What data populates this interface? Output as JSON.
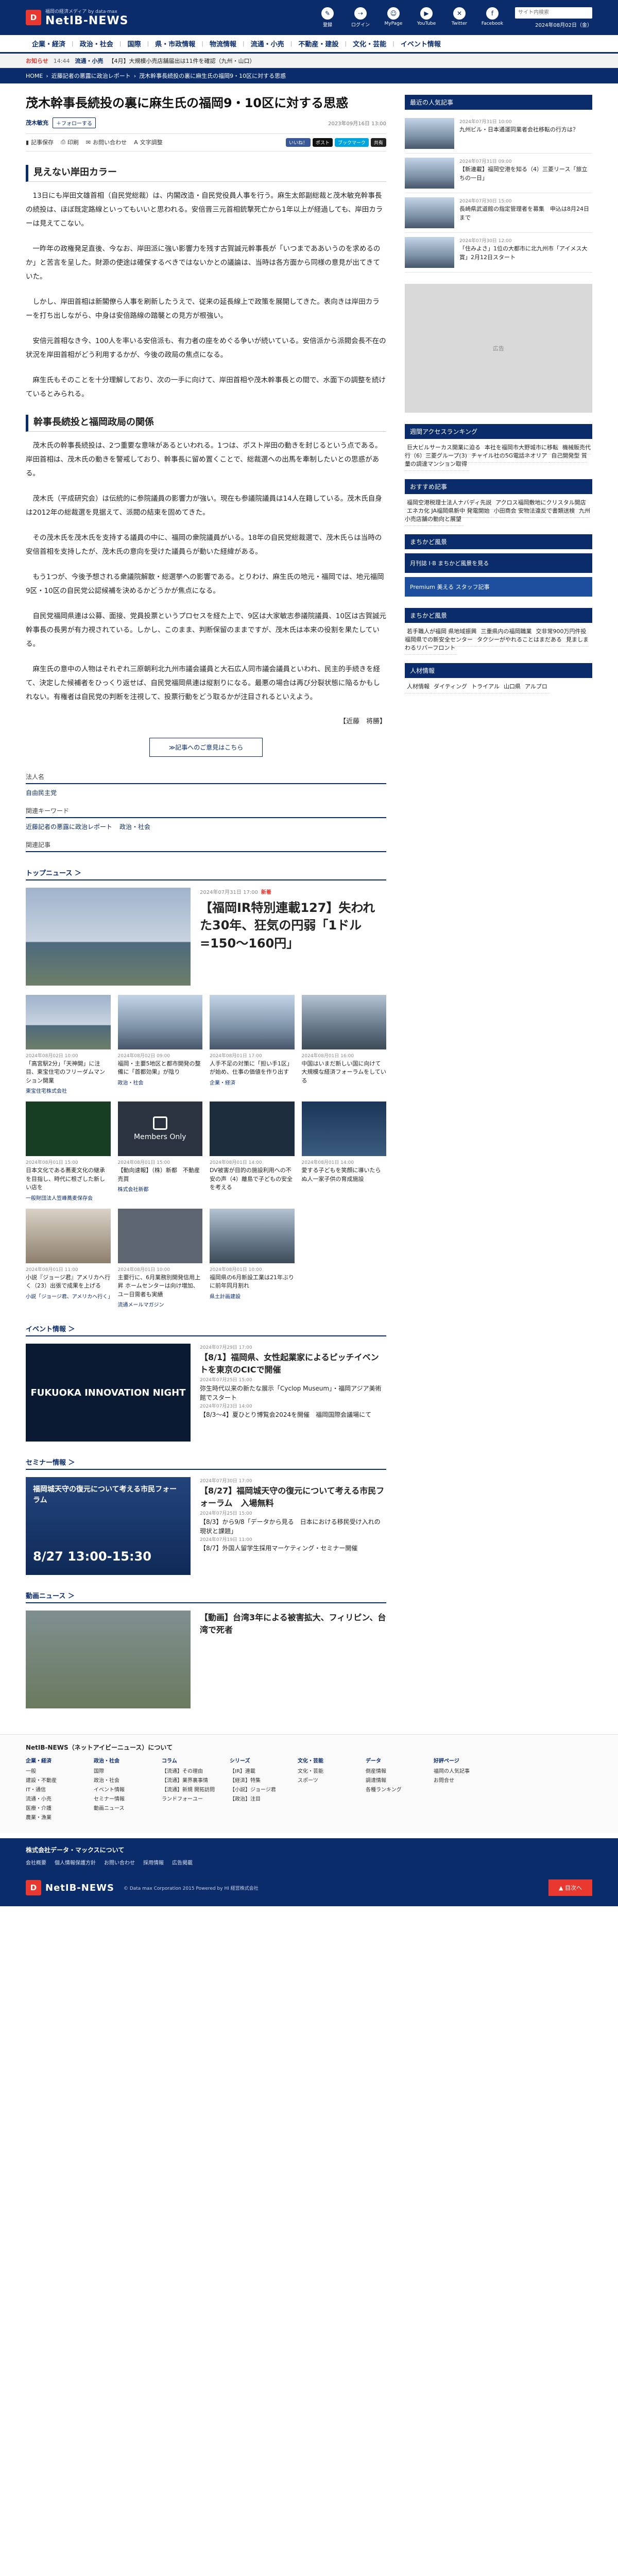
{
  "header": {
    "logo_mark": "D",
    "logo_sub": "福岡の経済メディア by data·max",
    "logo_main": "NetIB-NEWS",
    "icons": [
      {
        "label": "登録",
        "glyph": "✎"
      },
      {
        "label": "ログイン",
        "glyph": "⇢"
      },
      {
        "label": "MyPage",
        "glyph": "☺"
      },
      {
        "label": "YouTube",
        "glyph": "▶"
      },
      {
        "label": "Twitter",
        "glyph": "✕"
      },
      {
        "label": "Facebook",
        "glyph": "f"
      }
    ],
    "search_placeholder": "サイト内検索",
    "date": "2024年08月02日（金）"
  },
  "nav": [
    "企業・経済",
    "政治・社会",
    "国際",
    "県・市政情報",
    "物流情報",
    "流通・小売",
    "不動産・建設",
    "文化・芸能",
    "イベント情報"
  ],
  "ticker": {
    "label": "お知らせ",
    "time": "14:44",
    "tag": "流通・小売",
    "text": "【4月】大規模小売店舗届出は11件を確認（九州・山口）"
  },
  "breadcrumb": {
    "home": "HOME",
    "sep": "›",
    "cat": "近藤記者の悪露に政治レポート",
    "current": "茂木幹事長続投の裏に麻生氏の福岡9・10区に対する思惑"
  },
  "article": {
    "title": "茂木幹事長続投の裏に麻生氏の福岡9・10区に対する思惑",
    "author": "茂木敏充",
    "follow": "＋フォローする",
    "pubdate": "2023年09月16日 13:00",
    "tools": {
      "stock": "記事保存",
      "print": "印刷",
      "share": "お問い合わせ",
      "font": "文字調整"
    },
    "social": [
      "いいね！",
      "ポスト",
      "ブックマーク",
      "共有"
    ],
    "sections": [
      {
        "heading": "見えない岸田カラー",
        "paras": [
          "13日にも岸田文雄首相（自民党総裁）は、内閣改造・自民党役員人事を行う。麻生太郎副総裁と茂木敏充幹事長の続投は、ほぼ既定路線といってもいいと思われる。安倍晋三元首相銃撃死亡から1年以上が経過しても、岸田カラーは見えてこない。",
          "一昨年の政権発足直後、今なお、岸田派に強い影響力を残す古賀誠元幹事長が「いつまでああいうのを求めるのか」と苦言を呈した。財源の使途は確保するべきではないかとの議論は、当時は各方面から同様の意見が出てきていた。",
          "しかし、岸田首相は新閣僚ら人事を刷新したうえで、従来の延長線上で政策を展開してきた。表向きは岸田カラーを打ち出しながら、中身は安倍路線の踏襲との見方が根強い。",
          "安倍元首相なき今、100人を率いる安倍派も、有力者の座をめぐる争いが続いている。安倍派から派閥会長不在の状況を岸田首相がどう利用するかが、今後の政局の焦点になる。",
          "麻生氏もそのことを十分理解しており、次の一手に向けて、岸田首相や茂木幹事長との間で、水面下の調整を続けているとみられる。"
        ]
      },
      {
        "heading": "幹事長続投と福岡政局の関係",
        "paras": [
          "茂木氏の幹事長続投は、2つ重要な意味があるといわれる。1つは、ポスト岸田の動きを封じるという点である。岸田首相は、茂木氏の動きを警戒しており、幹事長に留め置くことで、総裁選への出馬を牽制したいとの思惑がある。",
          "茂木氏（平成研究会）は伝統的に参院議員の影響力が強い。現在も参議院議員は14人在籍している。茂木氏自身は2012年の総裁選を見据えて、派閥の結束を固めてきた。",
          "その茂木氏を茂木氏を支持する議員の中に、福岡の衆院議員がいる。18年の自民党総裁選で、茂木氏らは当時の安倍首相を支持したが、茂木氏の意向を受けた議員らが動いた経緯がある。",
          "もう1つが、今後予想される衆議院解散・総選挙への影響である。とりわけ、麻生氏の地元・福岡では、地元福岡9区・10区の自民党公認候補を決めるかどうかが焦点になる。",
          "自民党福岡県連は公募、面接、党員投票というプロセスを経た上で、9区は大家敏志参議院議員、10区は古賀誠元幹事長の長男が有力視されている。しかし、このまま、判断保留のままですが、茂木氏は本来の役割を果たしている。",
          "麻生氏の意中の人物はそれぞれ三原朝利北九州市議会議員と大石広人同市議会議員といわれ、民主的手続きを経て、決定した候補者をひっくり返せば、自民党福岡県連は縦割りになる。最悪の場合は再び分裂状態に陥るかもしれない。有権者は自民党の判断を注視して、投票行動をどう取るかが注目されるといえよう。"
        ]
      }
    ],
    "signature": "【近藤　将勝】",
    "more_btn": "≫記事へのご意見はこちら",
    "name_h": "法人名",
    "name_v": "自由民主党",
    "kw_h": "関連キーワード",
    "keywords": [
      "近藤記者の悪露に政治レポート",
      "政治・社会"
    ],
    "rel_h": "関連記事"
  },
  "topics": {
    "heading": "トップニュース ＞",
    "feature": {
      "date": "2024年07月31日 17:00",
      "new": "新着",
      "title": "【福岡IR特別連載127】失われた30年、狂気の円弱「1ドル=150〜160円」"
    },
    "cards": [
      {
        "date": "2024年08月02日 10:00",
        "title": "「高宮駅2分」「天神開」に注目、東宝住宅のフリーダムマンション開業",
        "cat": "東宝住宅株式会社",
        "img": "sky"
      },
      {
        "date": "2024年08月02日 09:00",
        "title": "福岡・主要5地区と都市開発の整備に「首都効果」が陰り",
        "cat": "政治・社会",
        "img": "city"
      },
      {
        "date": "2024年08月01日 17:00",
        "title": "人手不足の対策に「担い手1区」が始め、仕事の価値を作り出す",
        "cat": "企業・経済",
        "img": "city"
      },
      {
        "date": "2024年08月01日 16:00",
        "title": "中国はいまだ新しい国に向けて大規模な経済フォーラムをしている",
        "cat": "",
        "img": "aerial"
      },
      {
        "date": "2024年08月01日 15:00",
        "title": "日本文化である蕎麦文化の継承を目指し、時代に根ざした新しい店を",
        "cat": "一般財団法人笠峰蕎麦保存会",
        "img": "green"
      },
      {
        "date": "2024年08月01日 15:00",
        "title": "【動向速報】（株）新都　不動産売買",
        "cat": "株式会社新都",
        "img": "members"
      },
      {
        "date": "2024年08月01日 14:00",
        "title": "DV被害が目的の施設利用への不安の声（4）離島で子どもの安全を考える",
        "cat": "",
        "img": "dark"
      },
      {
        "date": "2024年08月01日 14:00",
        "title": "愛する子どもを笑顔に導いたらぬ人一家子供の育成施設",
        "cat": "",
        "img": "gold"
      },
      {
        "date": "2024年08月01日 11:00",
        "title": "小説『ジョージ君』アメリカへ行く（23）出張で成果を上げる",
        "cat": "小説「ジョージ君、アメリカへ行く」",
        "img": "crowd"
      },
      {
        "date": "2024年08月01日 10:00",
        "title": "主要行に、6月業務別開発信用上昇 ホームセンターは向け増加、ユー日需者も実績",
        "cat": "流通メールマガジン",
        "img": "gray"
      },
      {
        "date": "2024年08月01日 10:00",
        "title": "福岡県の6月新設工業は21年ぶりに前年同月割れ",
        "cat": "県土計画建設",
        "img": "aerial"
      },
      {
        "date": "",
        "title": "",
        "cat": "",
        "img": "none"
      }
    ]
  },
  "events": {
    "heading": "イベント情報 ＞",
    "poster": "FUKUOKA INNOVATION NIGHT",
    "items": [
      {
        "date": "2024年07月29日 17:00",
        "title": "【8/1】福岡県、女性起業家によるピッチイベントを東京のCICで開催",
        "big": true
      },
      {
        "date": "2024年07月25日 15:00",
        "title": "弥生時代以来の新たな展示「Cyclop Museum」・福岡アジア美術館でスタート",
        "big": false
      },
      {
        "date": "2024年07月23日 14:00",
        "title": "【8/3〜4】夏ひとり博覧会2024を開催　福岡国際会議場にて",
        "big": false
      }
    ]
  },
  "seminars": {
    "heading": "セミナー情報 ＞",
    "poster_title": "福岡城天守の復元について考える市民フォーラム",
    "poster_date": "8/27 13:00-15:30",
    "items": [
      {
        "date": "2024年07月30日 17:00",
        "title": "【8/27】福岡城天守の復元について考える市民フォーラム　入場無料",
        "big": true
      },
      {
        "date": "2024年07月25日 15:00",
        "title": "【8/3】から9/8「データから見る　日本における移民受け入れの現状と課題」",
        "big": false
      },
      {
        "date": "2024年07月19日 11:00",
        "title": "【8/7】外国人留学生採用マーケティング・セミナー開催",
        "big": false
      }
    ]
  },
  "video": {
    "heading": "動画ニュース ＞",
    "title": "【動画】台湾3年による被害拡大、フィリピン、台湾で死者"
  },
  "sidebar": {
    "ranking": {
      "heading": "最近の人気記事",
      "items": [
        {
          "date": "2024年07月31日 10:00",
          "title": "九州ビル・日本通運同業者会社移転の行方は？"
        },
        {
          "date": "2024年07月31日 09:00",
          "title": "【新連載】福岡空港を知る（4）三菱リース「旅立ちの一日」"
        },
        {
          "date": "2024年07月30日 15:00",
          "title": "長崎県武道館の指定管理者を募集　申込は8月24日まで"
        },
        {
          "date": "2024年07月30日 12:00",
          "title": "「住みよさ」1位の大都市に北九州市「アイメス大賞」2月12日スタート"
        }
      ]
    },
    "access": {
      "heading": "週間アクセスランキング",
      "items": [
        "巨大ビルサーカス開業に迫る",
        "本社を福岡市大野城市に移転",
        "機械販売代行（6）三菱グループ(3)",
        "チャイル社の5G電話ネオリア",
        "自己開発型 質量の調達マンション取得"
      ]
    },
    "recommend": {
      "heading": "おすすめ記事",
      "items": [
        "福岡空港税理士法人ナバディ先説",
        "アクロス福岡敷地にクリスタル開店",
        "エネカ化 JA福岡県新中 発電開始",
        "小田商会 安物法違反で書類送検",
        "九州小売店舗の動向と展望"
      ]
    },
    "magazine": {
      "heading": "まちかど風景",
      "banner1": "月刊誌 I·B まちかど風景を見る",
      "banner2": "Premium 美える スタッフ記事"
    },
    "mag_list": {
      "heading": "まちかど風景",
      "items": [
        "若手職人が福岡 県地域振興",
        "三重県内の福岡職業",
        "交非常900万円件投 福岡県での新安全センター",
        "タクシーがやれることはまだある",
        "見ましまわるリバーフロント"
      ]
    },
    "people": {
      "heading": "人材情報",
      "items": [
        "人材情報",
        "ダイティング",
        "トライアル",
        "山口県",
        "アルプロ"
      ]
    },
    "ad_label": "広告"
  },
  "footer": {
    "about_h": "NetIB-NEWS（ネットアイビーニュース）について",
    "cols": [
      {
        "h": "企業・経済",
        "items": [
          "一般",
          "建設・不動産",
          "IT・通信",
          "流通・小売",
          "医療・介護",
          "農業・漁業"
        ]
      },
      {
        "h": "政治・社会",
        "items": [
          "国際",
          "政治・社会",
          "イベント情報",
          "セミナー情報",
          "動画ニュース"
        ]
      },
      {
        "h": "コラム",
        "items": [
          "【流通】その理由",
          "【流通】業界裏事情",
          "【流通】新規 開拓訪問",
          "ランドフォーユー"
        ]
      },
      {
        "h": "シリーズ",
        "items": [
          "【IR】連載",
          "【経済】特集",
          "【小説】ジョージ君",
          "【政治】注目"
        ]
      },
      {
        "h": "文化・芸能",
        "items": [
          "文化・芸能",
          "スポーツ"
        ]
      },
      {
        "h": "データ",
        "items": [
          "倒産情報",
          "調達情報",
          "各種ランキング"
        ]
      },
      {
        "h": "好評ページ",
        "items": [
          "福岡の人気記事",
          "お問合せ"
        ]
      }
    ],
    "corp_h": "株式会社データ・マックスについて",
    "corp_links": [
      "会社概要",
      "個人情報保護方針",
      "お問い合わせ",
      "採用情報",
      "広告掲載"
    ],
    "copyright": "© Data max Corporation 2015 Powered by HI 経営株式会社",
    "to_top": "▲ 目次へ"
  }
}
